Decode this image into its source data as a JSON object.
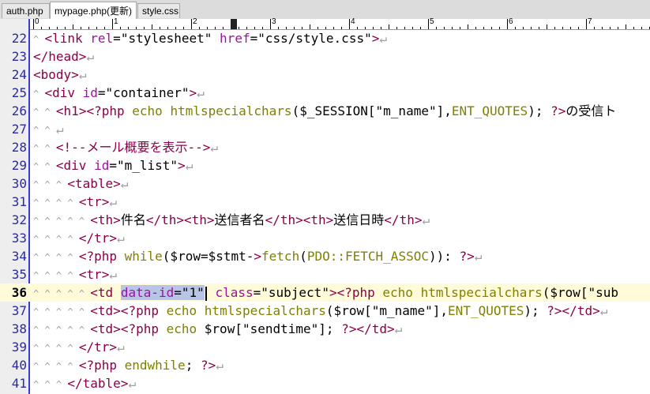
{
  "tabs": [
    {
      "label": "auth.php",
      "active": false
    },
    {
      "label": "mypage.php(更新)",
      "active": true
    },
    {
      "label": "style.css",
      "active": false
    }
  ],
  "ruler": {
    "marks": [
      "0",
      "1",
      "2",
      "3",
      "4",
      "5",
      "6",
      "7"
    ]
  },
  "editor": {
    "current_line": 36,
    "lines": [
      {
        "num": "22",
        "indent": 1,
        "code": "<link rel=\"stylesheet\" href=\"css/style.css\">"
      },
      {
        "num": "23",
        "indent": 0,
        "code": "</head>"
      },
      {
        "num": "24",
        "indent": 0,
        "code": "<body>"
      },
      {
        "num": "25",
        "indent": 1,
        "code": "<div id=\"container\">"
      },
      {
        "num": "26",
        "indent": 2,
        "code": "<h1><?php echo htmlspecialchars($_SESSION[\"m_name\"],ENT_QUOTES); ?>の受信ト"
      },
      {
        "num": "27",
        "indent": 2,
        "code": ""
      },
      {
        "num": "28",
        "indent": 2,
        "code": "<!--メール概要を表示-->"
      },
      {
        "num": "29",
        "indent": 2,
        "code": "<div id=\"m_list\">"
      },
      {
        "num": "30",
        "indent": 3,
        "code": "<table>"
      },
      {
        "num": "31",
        "indent": 4,
        "code": "<tr>"
      },
      {
        "num": "32",
        "indent": 5,
        "code": "<th>件名</th><th>送信者名</th><th>送信日時</th>"
      },
      {
        "num": "33",
        "indent": 4,
        "code": "</tr>"
      },
      {
        "num": "34",
        "indent": 4,
        "code": "<?php while($row=$stmt->fetch(PDO::FETCH_ASSOC)): ?>"
      },
      {
        "num": "35",
        "indent": 4,
        "code": "<tr>"
      },
      {
        "num": "36",
        "indent": 5,
        "code": "<td data-id=\"1\" class=\"subject\"><?php echo htmlspecialchars($row[\"sub"
      },
      {
        "num": "37",
        "indent": 5,
        "code": "<td><?php echo htmlspecialchars($row[\"m_name\"],ENT_QUOTES); ?></td>"
      },
      {
        "num": "38",
        "indent": 5,
        "code": "<td><?php echo $row[\"sendtime\"]; ?></td>"
      },
      {
        "num": "39",
        "indent": 4,
        "code": "</tr>"
      },
      {
        "num": "40",
        "indent": 4,
        "code": "<?php endwhile; ?>"
      },
      {
        "num": "41",
        "indent": 3,
        "code": "</table>"
      }
    ]
  },
  "colors": {
    "tag": "#8b0048",
    "attribute": "#a010a0",
    "php_keyword": "#808000",
    "gutter_border": "#3b3bd6",
    "current_line_bg": "#fffbd9",
    "selection": "#b9c5e6"
  }
}
